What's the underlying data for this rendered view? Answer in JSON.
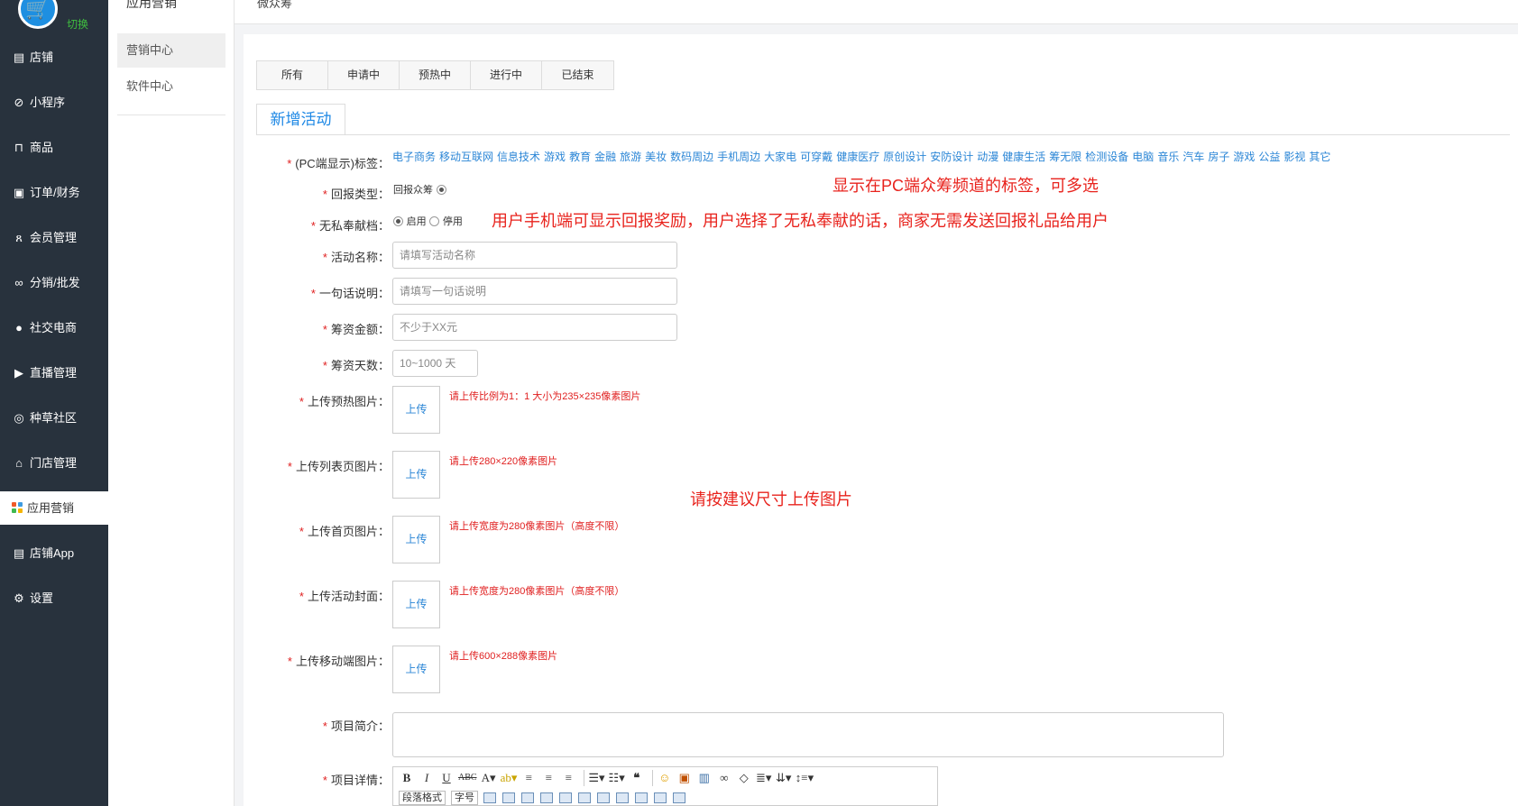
{
  "sidebar": {
    "switch_label": "切换",
    "items": [
      {
        "label": "店铺",
        "icon": "store-icon"
      },
      {
        "label": "小程序",
        "icon": "mini-program-icon"
      },
      {
        "label": "商品",
        "icon": "bag-icon"
      },
      {
        "label": "订单/财务",
        "icon": "order-icon"
      },
      {
        "label": "会员管理",
        "icon": "member-icon"
      },
      {
        "label": "分销/批发",
        "icon": "share-icon"
      },
      {
        "label": "社交电商",
        "icon": "chat-icon"
      },
      {
        "label": "直播管理",
        "icon": "live-icon"
      },
      {
        "label": "种草社区",
        "icon": "community-icon"
      },
      {
        "label": "门店管理",
        "icon": "shop-icon"
      },
      {
        "label": "应用营销",
        "icon": "apps-icon"
      },
      {
        "label": "店铺App",
        "icon": "store-app-icon"
      },
      {
        "label": "设置",
        "icon": "gear-icon"
      }
    ]
  },
  "subside": {
    "title": "应用营销",
    "items": [
      {
        "label": "营销中心"
      },
      {
        "label": "软件中心"
      }
    ]
  },
  "topbar": {
    "breadcrumb": "微众筹"
  },
  "tabs": [
    {
      "label": "所有"
    },
    {
      "label": "申请中"
    },
    {
      "label": "预热中"
    },
    {
      "label": "进行中"
    },
    {
      "label": "已结束"
    }
  ],
  "section_title": "新增活动",
  "form": {
    "tags_label": "(PC端显示)标签：",
    "tags": [
      "电子商务",
      "移动互联网",
      "信息技术",
      "游戏",
      "教育",
      "金融",
      "旅游",
      "美妆",
      "数码周边",
      "手机周边",
      "大家电",
      "可穿戴",
      "健康医疗",
      "原创设计",
      "安防设计",
      "动漫",
      "健康生活",
      "筹无限",
      "检测设备",
      "电脑",
      "音乐",
      "汽车",
      "房子",
      "游戏",
      "公益",
      "影视",
      "其它"
    ],
    "return_type_label": "回报类型：",
    "return_type_option": "回报众筹",
    "selfless_label": "无私奉献档：",
    "selfless_on": "启用",
    "selfless_off": "停用",
    "name_label": "活动名称：",
    "name_placeholder": "请填写活动名称",
    "slogan_label": "一句话说明：",
    "slogan_placeholder": "请填写一句话说明",
    "amount_label": "筹资金额：",
    "amount_placeholder": "不少于XX元",
    "days_label": "筹资天数：",
    "days_placeholder": "10~1000 天",
    "upload_label": "上传",
    "preheat_label": "上传预热图片：",
    "preheat_hint": "请上传比例为1：1 大小为235×235像素图片",
    "list_label": "上传列表页图片：",
    "list_hint": "请上传280×220像素图片",
    "home_label": "上传首页图片：",
    "home_hint": "请上传宽度为280像素图片（高度不限）",
    "cover_label": "上传活动封面：",
    "cover_hint": "请上传宽度为280像素图片（高度不限）",
    "mobile_label": "上传移动端图片：",
    "mobile_hint": "请上传600×288像素图片",
    "intro_label": "项目简介：",
    "detail_label": "项目详情："
  },
  "annotations": {
    "tags_note": "显示在PC端众筹频道的标签，可多选",
    "selfless_note": "用户手机端可显示回报奖励，用户选择了无私奉献的话，商家无需发送回报礼品给用户",
    "upload_note": "请按建议尺寸上传图片"
  },
  "editor": {
    "paragraph_select": "段落格式",
    "fontsize_select": "字号"
  },
  "colors": {
    "sidebar_bg": "#28323d",
    "accent": "#1e88e5",
    "annotation": "#e8231d",
    "required": "#e02020"
  }
}
